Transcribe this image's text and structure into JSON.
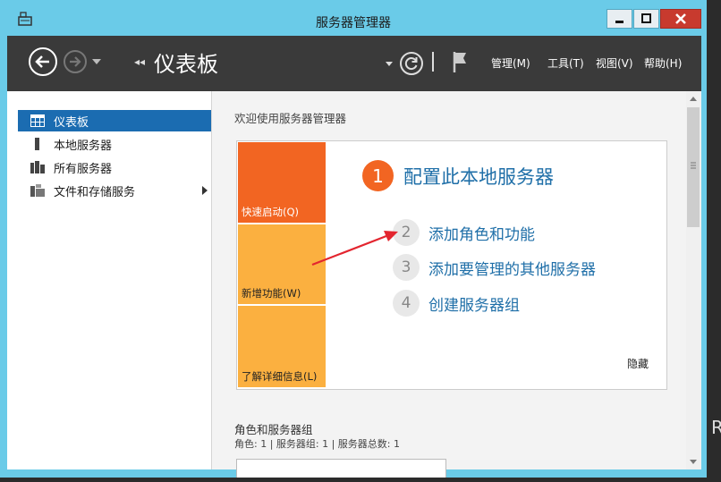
{
  "window": {
    "title": "服务器管理器"
  },
  "toolbar": {
    "breadcrumb_title": "仪表板",
    "menus": [
      "管理(M)",
      "工具(T)",
      "视图(V)",
      "帮助(H)"
    ]
  },
  "nav": {
    "items": [
      {
        "label": "仪表板",
        "icon": "dashboard-icon",
        "active": true
      },
      {
        "label": "本地服务器",
        "icon": "local-server-icon"
      },
      {
        "label": "所有服务器",
        "icon": "all-servers-icon"
      },
      {
        "label": "文件和存储服务",
        "icon": "file-storage-icon",
        "expandable": true
      }
    ]
  },
  "welcome": {
    "title": "欢迎使用服务器管理器",
    "tiles": [
      "快速启动(Q)",
      "新增功能(W)",
      "了解详细信息(L)"
    ],
    "steps": [
      {
        "num": "1",
        "text": "配置此本地服务器"
      },
      {
        "num": "2",
        "text": "添加角色和功能"
      },
      {
        "num": "3",
        "text": "添加要管理的其他服务器"
      },
      {
        "num": "4",
        "text": "创建服务器组"
      }
    ],
    "hide_label": "隐藏"
  },
  "roles": {
    "title": "角色和服务器组",
    "summary": "角色: 1 | 服务器组: 1 | 服务器总数: 1"
  },
  "colors": {
    "accent": "#f26522",
    "tile": "#fbb040",
    "link": "#1f6fa8",
    "selection": "#1b6cb1",
    "titlebar": "#6acbe8"
  },
  "edge_char": "R"
}
